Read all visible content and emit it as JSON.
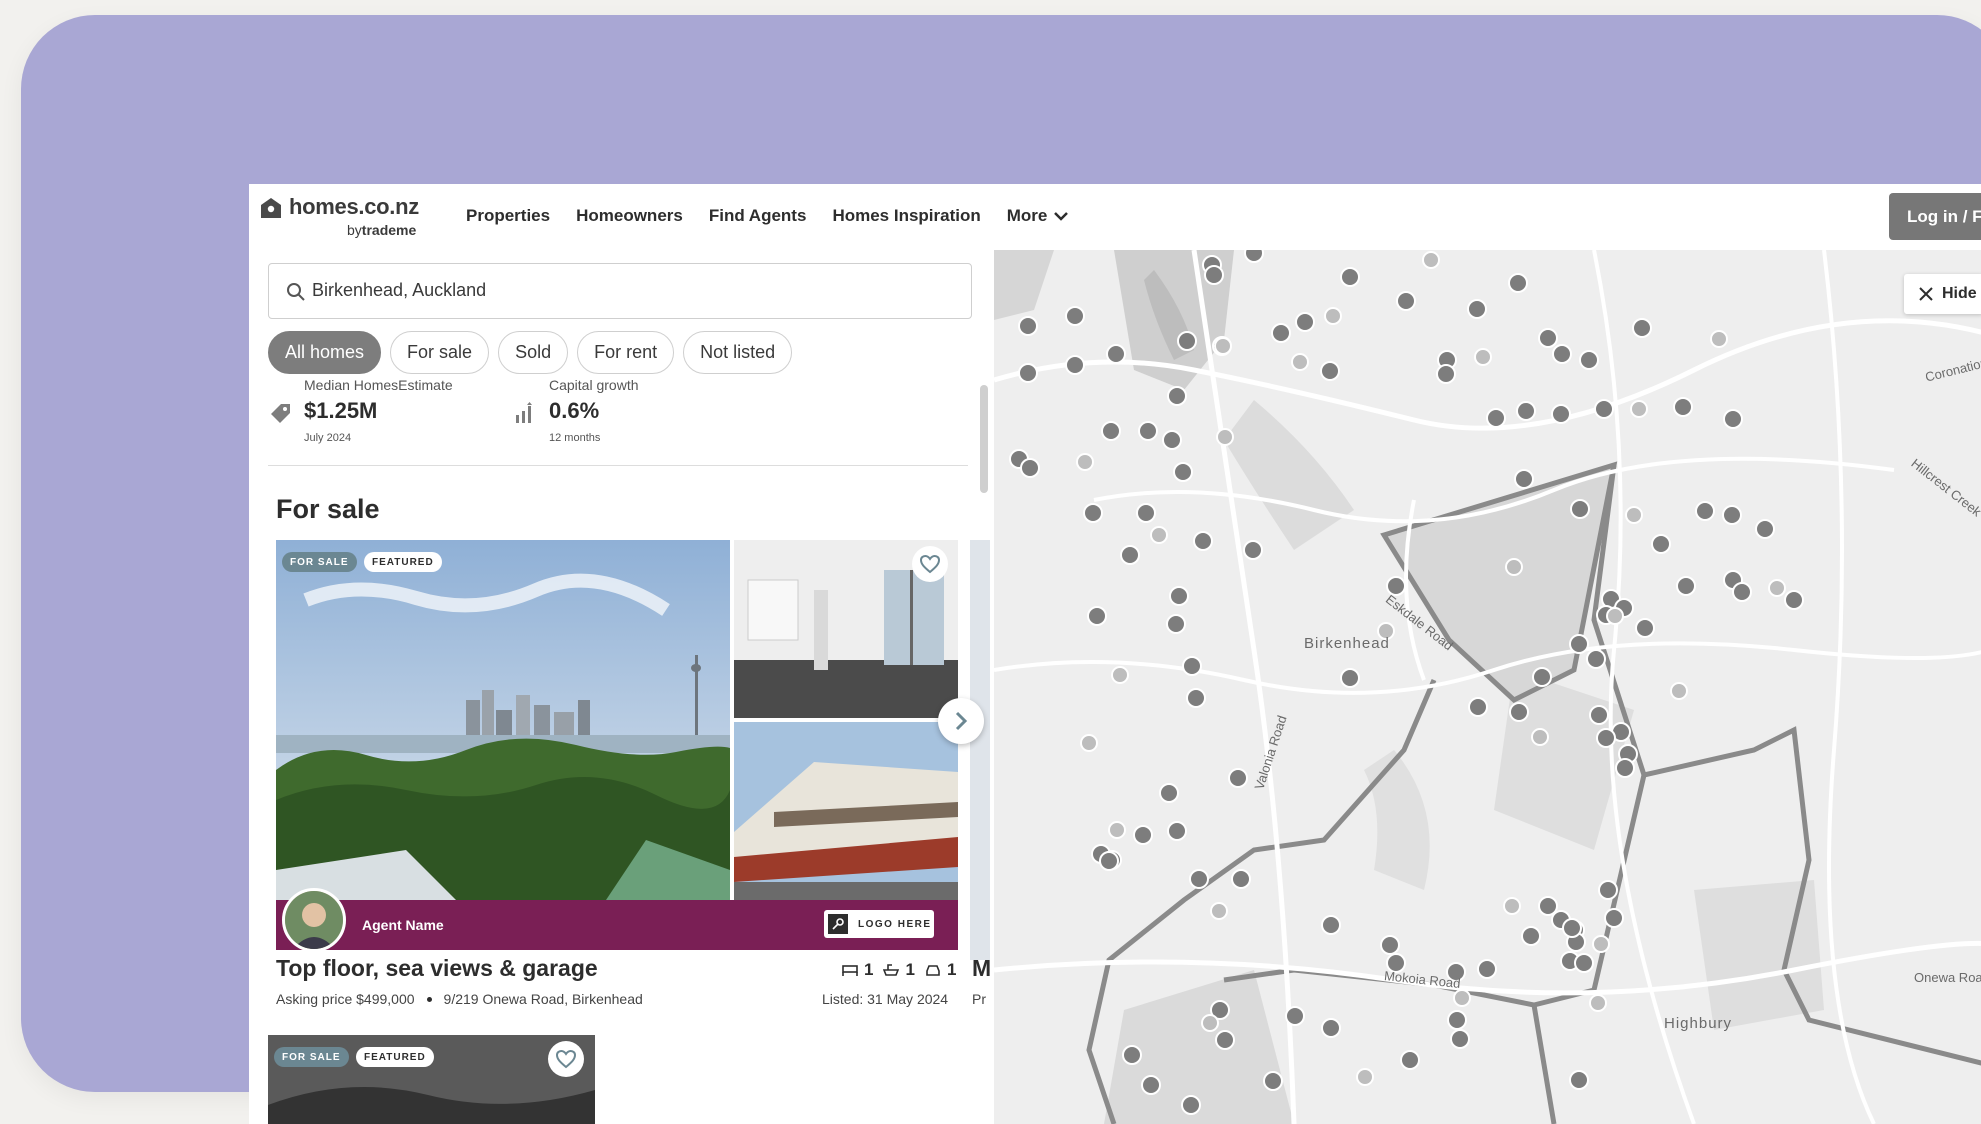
{
  "brand": {
    "name": "homes.co.nz",
    "by": "by",
    "parent": "trademe"
  },
  "nav": {
    "items": [
      "Properties",
      "Homeowners",
      "Find Agents",
      "Homes Inspiration",
      "More"
    ],
    "login": "Log in / F"
  },
  "search": {
    "value": "Birkenhead, Auckland"
  },
  "filters": {
    "chips": [
      "All homes",
      "For sale",
      "Sold",
      "For rent",
      "Not listed"
    ],
    "active": "All homes"
  },
  "stats": [
    {
      "label": "Median HomesEstimate",
      "value": "$1.25M",
      "sub": "July 2024",
      "icon": "price-tag-icon"
    },
    {
      "label": "Capital growth",
      "value": "0.6%",
      "sub": "12 months",
      "icon": "growth-chart-icon"
    }
  ],
  "section": {
    "title": "For sale"
  },
  "listing": {
    "badges": [
      "FOR SALE",
      "FEATURED"
    ],
    "agent_name": "Agent Name",
    "agency_logo_text": "LOGO HERE",
    "title": "Top floor, sea views & garage",
    "price": "Asking price $499,000",
    "address": "9/219 Onewa Road, Birkenhead",
    "bedrooms": "1",
    "bathrooms": "1",
    "parking": "1",
    "listed": "Listed: 31 May 2024",
    "peek_title": "M",
    "peek_sub": "Pr"
  },
  "listing2": {
    "badges": [
      "FOR SALE",
      "FEATURED"
    ]
  },
  "map": {
    "hide_label": "Hide",
    "labels": [
      "Coronation Road",
      "Hillcrest Creek",
      "Eskdale Road",
      "Birkenhead",
      "Valonia Road",
      "Mokoia Road",
      "Highbury",
      "Onewa Road"
    ]
  },
  "colors": {
    "frame": "#a9a7d4",
    "agent_bar": "#7a1f55",
    "badge": "#6b8792",
    "map_bg": "#eeeeee",
    "marker": "#7d7d7d"
  }
}
